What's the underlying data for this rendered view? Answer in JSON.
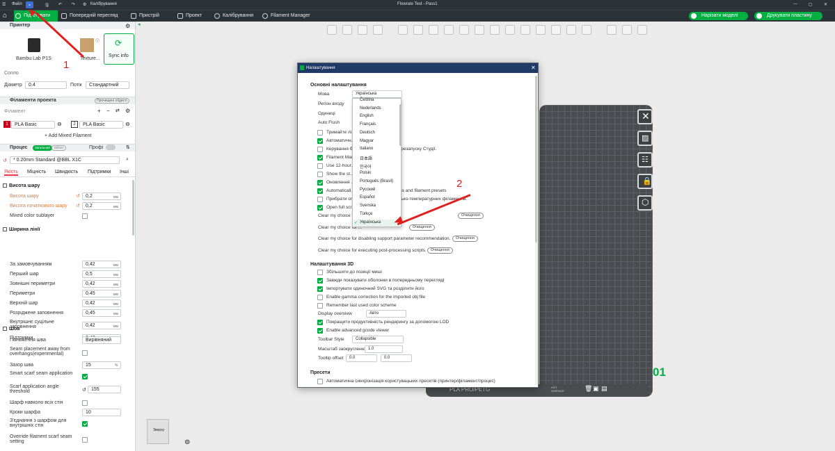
{
  "titlebar": {
    "file": "Файл",
    "calib": "Калібрування",
    "project_title": "Flowrate Test - Pass1"
  },
  "tabs": [
    {
      "label": "Підготувати"
    },
    {
      "label": "Попередній перегляд"
    },
    {
      "label": "Пристрій"
    },
    {
      "label": "Проект"
    },
    {
      "label": "Калібрування"
    },
    {
      "label": "Filament Manager"
    }
  ],
  "actions": {
    "slice": "Нарізати моделі",
    "print": "Друкувати пластину"
  },
  "printer": {
    "section": "Принтер",
    "name": "Bambu Lab P1S",
    "plate": "Texture...",
    "sync": "Sync info",
    "nozzle_label": "Сопло",
    "diameter_label": "Діаметр",
    "diameter": "0.4",
    "flow_label": "Потік",
    "flow": "Стандартний"
  },
  "filaments": {
    "section": "Філаменти проекта",
    "badge": "Прочищені обдисті",
    "label": "Філамент",
    "slots": [
      {
        "num": "1",
        "name": "PLA Basic"
      },
      {
        "num": "2",
        "name": "PLA Basic"
      }
    ],
    "add_mixed": "+ Add Mixed Filament"
  },
  "process": {
    "section": "Процес",
    "tag_global": "Загальний",
    "tag_object": "Об'єкт",
    "profile_label": "Профі",
    "profile": "* 0.20mm Standard @BBL X1C",
    "tabs": [
      "Якість",
      "Міцність",
      "Швидкість",
      "Підтримки",
      "Інші"
    ]
  },
  "quality": {
    "layer_height": {
      "title": "Висота шару",
      "rows": [
        {
          "label": "Висота шару",
          "value": "0,2",
          "unit": "мм"
        },
        {
          "label": "Висота початкового шару",
          "value": "0,2",
          "unit": "мм"
        }
      ],
      "mixed": "Mixed color sublayer"
    },
    "line_width": {
      "title": "Ширина лінії",
      "rows": [
        {
          "label": "За замовчуванням",
          "value": "0,42",
          "unit": "мм"
        },
        {
          "label": "Перший шар",
          "value": "0,5",
          "unit": "мм"
        },
        {
          "label": "Зовнішні периметри",
          "value": "0,42",
          "unit": "мм"
        },
        {
          "label": "Периметри",
          "value": "0,45",
          "unit": "мм"
        },
        {
          "label": "Верхній шар",
          "value": "0,42",
          "unit": "мм"
        },
        {
          "label": "Розріджене заповнення",
          "value": "0,45",
          "unit": "мм"
        },
        {
          "label": "Внутрішнє суцільне заповнення",
          "value": "0,42",
          "unit": "мм"
        },
        {
          "label": "Підтримки",
          "value": "0,42",
          "unit": "мм"
        }
      ]
    },
    "seam": {
      "title": "Шов",
      "pos_label": "Положення шва",
      "pos": "Вирівняний",
      "away": "Seam placement away from overhangs(experimental)",
      "gap_label": "Зазор шва",
      "gap": "15",
      "gap_unit": "%",
      "smart": "Smart scarf seam application",
      "angle_label": "Scarf application angle threshold",
      "angle": "155",
      "around": "Шарф навколо всіх стін",
      "steps_label": "Кроки шарфа",
      "steps": "10",
      "inner": "З'єднання з шарфом для внутрішніх стін",
      "override": "Override filament scarf seam setting"
    }
  },
  "dialog": {
    "title": "Налаштування",
    "general": "Основні налаштування",
    "lang_label": "Мова",
    "lang_value": "Українська",
    "region": "Регіон входу",
    "units": "Одиниці",
    "autoflush": "Auto Flush",
    "opts": [
      "Тримайте лі... ...u Studio",
      "Автоматичн...",
      "Керування б... ...е чинності після перезапуску Студії.",
      "Filament Man... ...arting Studio)",
      "Use 12-hour...",
      "Show the st... ...dialog.",
      "Оновлення ...",
      "Automaticall... ...hen switching process and filament presets",
      "Прибрати ог... ...друк високо- та низько-температурних філаментів.",
      "Open full scr... ...monitor only."
    ],
    "clear": [
      "Clear my choice f... ...loading the file.",
      "Clear my choice for ...",
      "Clear my choice for disabling support parameter recommendation.",
      "Clear my choice for executing post-processing scripts."
    ],
    "clear_btn": "Очищення",
    "s3d": "Налаштування 3D",
    "s3d_opts": [
      "Збільшити до позиції миші",
      "Завжди показувати оболонки в попередньому перегляді",
      "Імпортувати одиночний SVG та розділити його",
      "Enable gamma correction for the imported obj file",
      "Remember last used color scheme"
    ],
    "overview_label": "Display overview",
    "overview": "Авто",
    "s3d_opts2": [
      "Покращити продуктивність рендерингу за допомогою LOD",
      "Enable advanced gcode viewer"
    ],
    "toolbar_label": "Toolbar Style",
    "toolbar": "Collapsible",
    "scale_label": "Масштаб заокруглення",
    "scale": "1.0",
    "tooltip_label": "Tooltip offset",
    "tooltip_x": "0.0",
    "tooltip_y": "0.0",
    "presets": "Пресети",
    "presets_opt": "Автоматична синхронізація користувацьких пресетів (принтер/філамент/процес)"
  },
  "languages": [
    "Čeština",
    "Nederlands",
    "English",
    "Français",
    "Deutsch",
    "Magyar",
    "Italiano",
    "日本語",
    "한국어",
    "Polski",
    "Português (Brasil)",
    "Русский",
    "Español",
    "Svenska",
    "Türkçe",
    "Українська"
  ],
  "plate": {
    "number": "01",
    "label": "PLA PRO/PETG",
    "surface": "HOT SURFACE"
  },
  "view": {
    "cube": "Зверху"
  },
  "annotations": {
    "one": "1",
    "two": "2"
  },
  "colors": {
    "accent": "#00ae42",
    "arrow": "#e0201c",
    "dark": "#2b3238"
  }
}
